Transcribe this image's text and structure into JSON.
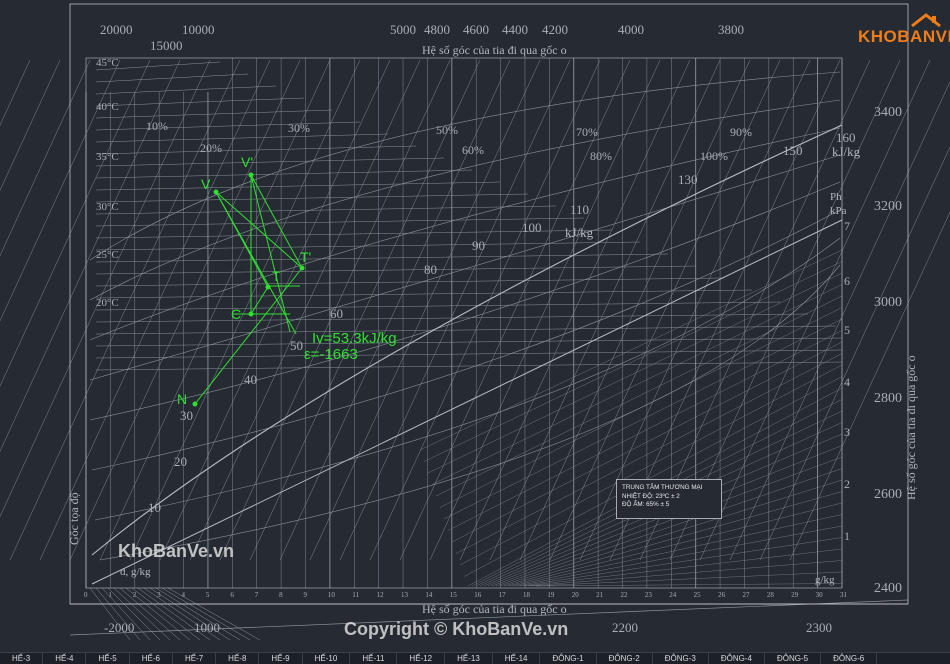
{
  "diagram": {
    "title_top": "Hệ số góc của tia đi qua gốc o",
    "title_bottom": "Hệ số góc của tia đi qua gốc o",
    "right_axis_title": "Hệ số góc của tia đi qua gốc o",
    "origin_label": "Gốc tọa độ",
    "top_scale": [
      "20000",
      "10000",
      "15000",
      "5000",
      "4800",
      "4600",
      "4400",
      "4200",
      "4000",
      "3800"
    ],
    "right_scale": [
      "3400",
      "3200",
      "3000",
      "2800",
      "2600",
      "2400"
    ],
    "bottom_scale": [
      "-2000",
      "1000",
      "2200",
      "2300"
    ],
    "enthalpy_labels": [
      "160",
      "150",
      "130",
      "110",
      "100",
      "90",
      "80",
      "60",
      "50",
      "40",
      "30",
      "20",
      "10"
    ],
    "enthalpy_unit_1": "kJ/kg",
    "enthalpy_unit_2": "kJ/kg",
    "rh_labels": [
      "10%",
      "20%",
      "30%",
      "50%",
      "60%",
      "70%",
      "80%",
      "90%",
      "100%"
    ],
    "temp_labels": [
      "45°C",
      "40°C",
      "35°C",
      "30°C",
      "25°C",
      "20°C"
    ],
    "pressure_title": "Ph",
    "pressure_unit": "kPa",
    "pressure_labels": [
      "7",
      "6",
      "5",
      "4",
      "3",
      "2",
      "1"
    ],
    "moisture_unit": "g/kg",
    "moisture_unit_left": "d, g/kg",
    "moisture_ticks": [
      "0",
      "1",
      "2",
      "3",
      "4",
      "5",
      "6",
      "7",
      "8",
      "9",
      "10",
      "11",
      "12",
      "13",
      "14",
      "15",
      "16",
      "17",
      "18",
      "19",
      "20",
      "21",
      "22",
      "23",
      "24",
      "25",
      "26",
      "27",
      "28",
      "29",
      "30",
      "31"
    ],
    "points": [
      {
        "label": "V'",
        "id": "v-prime"
      },
      {
        "label": "V",
        "id": "v"
      },
      {
        "label": "T'",
        "id": "t-prime"
      },
      {
        "label": "T",
        "id": "t"
      },
      {
        "label": "C",
        "id": "c"
      },
      {
        "label": "N",
        "id": "n"
      }
    ],
    "result_iv": "Iv=53.3kJ/kg",
    "result_eps": "ε=-1663"
  },
  "info_box": {
    "line1": "TRUNG TÂM THƯƠNG MẠI",
    "line2": "NHIỆT ĐỘ: 23ºC ± 2",
    "line3": "ĐỘ ẨM: 65% ± 5"
  },
  "watermarks": {
    "left": "KhoBanVe.vn",
    "bottom": "Copyright © KhoBanVe.vn",
    "logo": "KHOBANVE"
  },
  "tabs": [
    "HẾ-3",
    "HẾ-4",
    "HẾ-5",
    "HẾ-6",
    "HẾ-7",
    "HẾ-8",
    "HẾ-9",
    "HẾ-10",
    "HẾ-11",
    "HẾ-12",
    "HẾ-13",
    "HẾ-14",
    "ĐÔNG-1",
    "ĐÔNG-2",
    "ĐÔNG-3",
    "ĐÔNG-4",
    "ĐÔNG-5",
    "ĐÔNG-6"
  ],
  "colors": {
    "background": "#262b33",
    "grid": "#9aa0a8",
    "process": "#2fe02f",
    "logo": "#ef7d1a"
  }
}
